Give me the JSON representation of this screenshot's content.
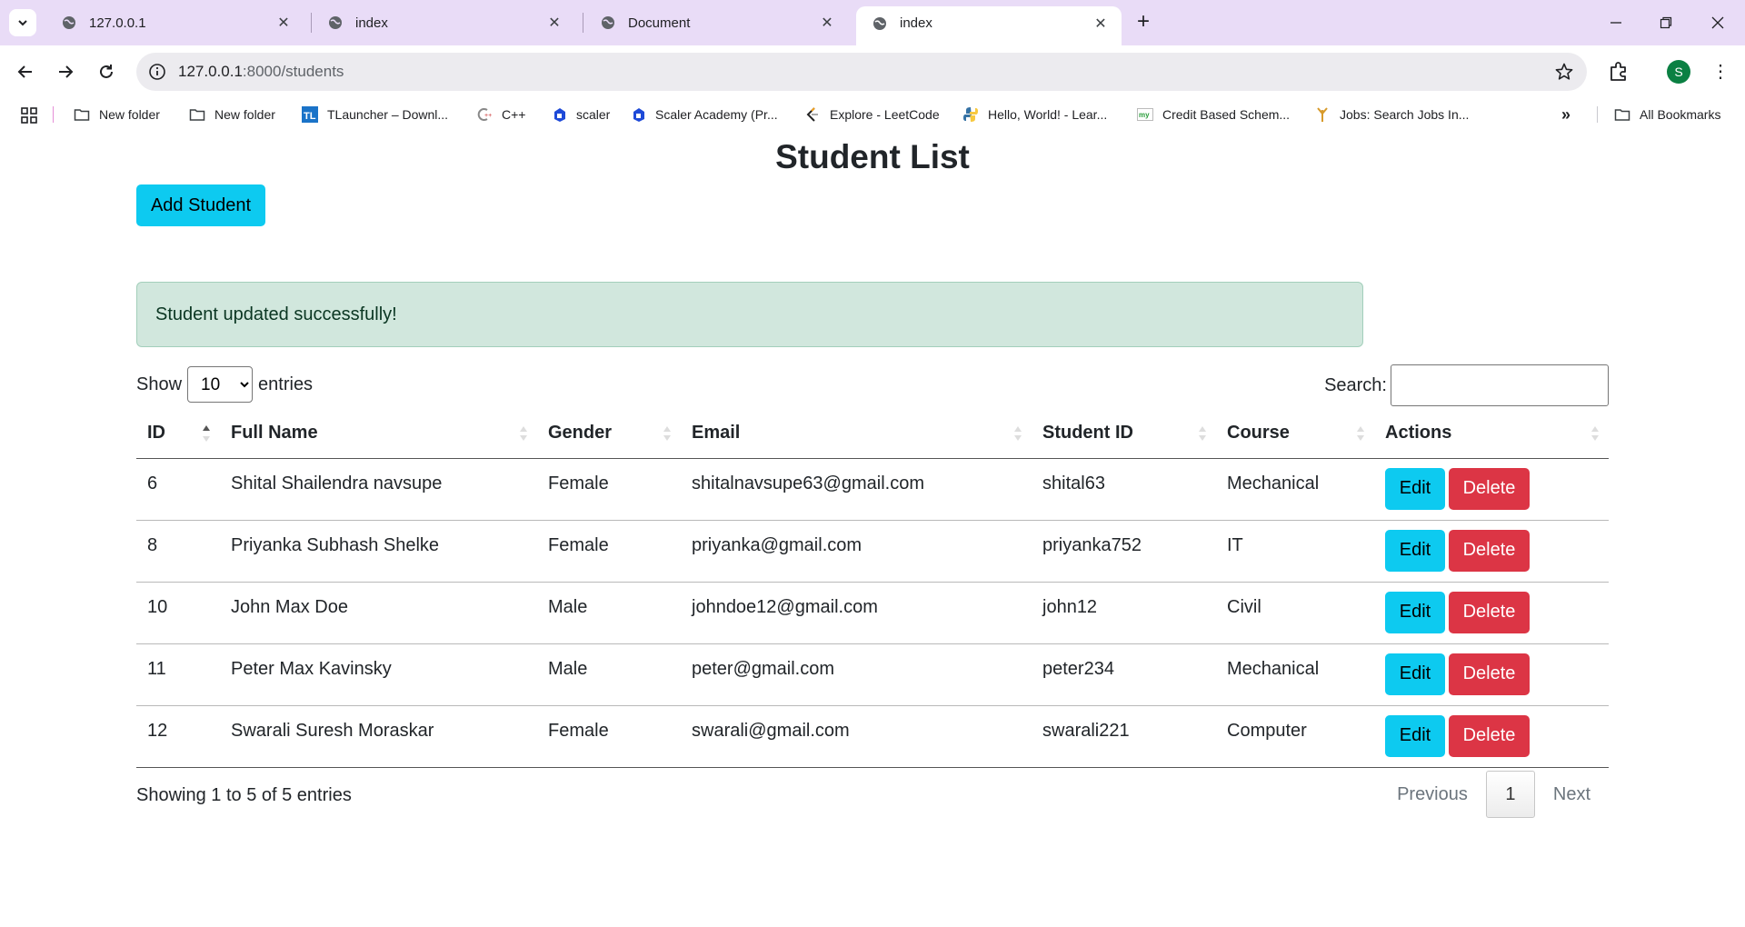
{
  "browser": {
    "tabs": [
      {
        "title": "127.0.0.1",
        "active": false
      },
      {
        "title": "index",
        "active": false
      },
      {
        "title": "Document",
        "active": false
      },
      {
        "title": "index",
        "active": true
      }
    ],
    "url_host": "127.0.0.1",
    "url_path": ":8000/students",
    "profile_initial": "S",
    "bookmarks": [
      {
        "label": "New folder",
        "icon": "folder-icon"
      },
      {
        "label": "New folder",
        "icon": "folder-icon"
      },
      {
        "label": "TLauncher – Downl...",
        "icon": "tlauncher-icon"
      },
      {
        "label": "C++",
        "icon": "cpp-icon"
      },
      {
        "label": "scaler",
        "icon": "scaler-icon"
      },
      {
        "label": "Scaler Academy (Pr...",
        "icon": "scaler-icon"
      },
      {
        "label": "Explore - LeetCode",
        "icon": "leetcode-icon"
      },
      {
        "label": "Hello, World! - Lear...",
        "icon": "python-icon"
      },
      {
        "label": "Credit Based Schem...",
        "icon": "my-icon"
      },
      {
        "label": "Jobs: Search Jobs In...",
        "icon": "jobs-icon"
      }
    ],
    "all_bookmarks": "All Bookmarks",
    "colors": {
      "tabstrip": "#e9dcf7",
      "omnibox": "#ecebef",
      "avatar": "#0b8043"
    }
  },
  "page": {
    "title": "Student List",
    "add_button": "Add Student",
    "alert": "Student updated successfully!",
    "length_prefix": "Show",
    "length_value": "10",
    "length_suffix": "entries",
    "search_label": "Search:",
    "search_value": "",
    "columns": [
      "ID",
      "Full Name",
      "Gender",
      "Email",
      "Student ID",
      "Course",
      "Actions"
    ],
    "rows": [
      {
        "id": "6",
        "name": "Shital Shailendra navsupe",
        "gender": "Female",
        "email": "shitalnavsupe63@gmail.com",
        "student_id": "shital63",
        "course": "Mechanical"
      },
      {
        "id": "8",
        "name": "Priyanka Subhash Shelke",
        "gender": "Female",
        "email": "priyanka@gmail.com",
        "student_id": "priyanka752",
        "course": "IT"
      },
      {
        "id": "10",
        "name": "John Max Doe",
        "gender": "Male",
        "email": "johndoe12@gmail.com",
        "student_id": "john12",
        "course": "Civil"
      },
      {
        "id": "11",
        "name": "Peter Max Kavinsky",
        "gender": "Male",
        "email": "peter@gmail.com",
        "student_id": "peter234",
        "course": "Mechanical"
      },
      {
        "id": "12",
        "name": "Swarali Suresh Moraskar",
        "gender": "Female",
        "email": "swarali@gmail.com",
        "student_id": "swarali221",
        "course": "Computer"
      }
    ],
    "edit_label": "Edit",
    "delete_label": "Delete",
    "info": "Showing 1 to 5 of 5 entries",
    "pagination": {
      "previous": "Previous",
      "current": "1",
      "next": "Next"
    },
    "colors": {
      "info_button": "#0dcaf0",
      "danger_button": "#dc3545",
      "alert_bg": "#d1e7dd"
    }
  }
}
